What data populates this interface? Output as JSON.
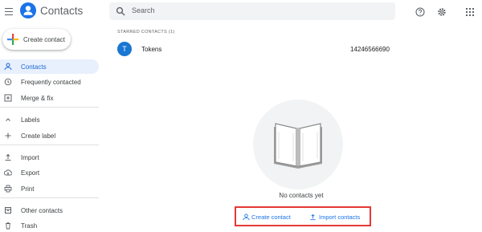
{
  "header": {
    "app_title": "Contacts",
    "search_placeholder": "Search"
  },
  "sidebar": {
    "create_contact": "Create contact",
    "items": [
      {
        "label": "Contacts",
        "icon": "person-icon",
        "active": true
      },
      {
        "label": "Frequently contacted",
        "icon": "history-icon"
      },
      {
        "label": "Merge & fix",
        "icon": "merge-icon"
      },
      {
        "label": "Labels",
        "icon": "chevron-up-icon"
      },
      {
        "label": "Create label",
        "icon": "plus-icon"
      },
      {
        "label": "Import",
        "icon": "upload-icon"
      },
      {
        "label": "Export",
        "icon": "cloud-download-icon"
      },
      {
        "label": "Print",
        "icon": "printer-icon"
      },
      {
        "label": "Other contacts",
        "icon": "archive-icon"
      },
      {
        "label": "Trash",
        "icon": "trash-icon"
      }
    ]
  },
  "main": {
    "starred_label": "STARRED CONTACTS (1)",
    "contacts": [
      {
        "initial": "T",
        "name": "Tokens",
        "phone": "14246566690",
        "avatar_color": "#1976d2"
      }
    ],
    "empty_text": "No contacts yet",
    "actions": {
      "create": "Create contact",
      "import": "Import contacts"
    }
  },
  "colors": {
    "accent": "#1a73e8",
    "active_bg": "#e8f0fe",
    "highlight_box": "#e53935"
  }
}
